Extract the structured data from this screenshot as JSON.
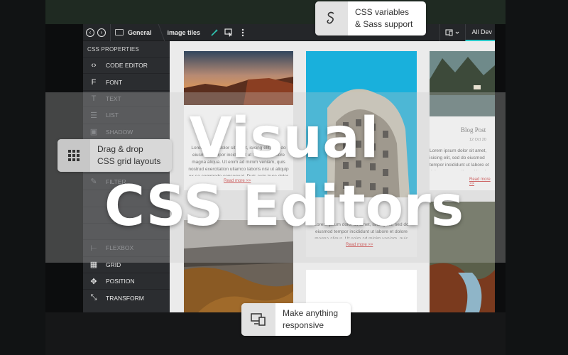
{
  "toolbar": {
    "back_icon": "arrow-left-circle",
    "forward_icon": "arrow-right-circle",
    "breadcrumb": [
      "General",
      "image tiles"
    ],
    "device_select": "All Dev"
  },
  "sidebar": {
    "header": "CSS PROPERTIES",
    "items": [
      {
        "label": "CODE EDITOR",
        "icon": "code-icon",
        "dim": false
      },
      {
        "label": "FONT",
        "icon": "font-icon",
        "dim": false
      },
      {
        "label": "TEXT",
        "icon": "text-icon",
        "dim": true
      },
      {
        "label": "LIST",
        "icon": "list-icon",
        "dim": true
      },
      {
        "label": "SHADOW",
        "icon": "shadow-icon",
        "dim": true
      },
      {
        "label": "",
        "icon": "",
        "dim": true
      },
      {
        "label": "",
        "icon": "",
        "dim": true
      },
      {
        "label": "FILTER",
        "icon": "filter-icon",
        "dim": true
      },
      {
        "label": "",
        "icon": "",
        "dim": true
      },
      {
        "label": "",
        "icon": "",
        "dim": true
      },
      {
        "label": "",
        "icon": "",
        "dim": true
      },
      {
        "label": "FLEXBOX",
        "icon": "flexbox-icon",
        "dim": true
      },
      {
        "label": "GRID",
        "icon": "grid-icon",
        "dim": false
      },
      {
        "label": "POSITION",
        "icon": "position-icon",
        "dim": false
      },
      {
        "label": "TRANSFORM",
        "icon": "transform-icon",
        "dim": false
      }
    ]
  },
  "content": {
    "cards": [
      {
        "title": "",
        "text": "Lorem ipsum dolor sit amet, isicing elit, sed do eiusmod tempor incididunt ut labore et dolore magna aliqua. Ut enim ad minim veniam, quis nostrud exercitation ullamco laboris nisi ut aliquip ex ea commodo consequat. Duis aute irure dolor in reprehenderit in voluptate velit esse cillum dolore eu fugiat nulla pariatur. Excepteur sint occaecat cupidatat non proident, sunt in culpa qui officia deserunt mollit anim id est laborum. Integer eget tellus ultrices, ullamcorper nibh id, fermentum felis. Mauris dignissim ut enim in auctor. Cras vel felis nec nibh finibus tincidunt. Proin ullamcorper tincidunt tellus, quis viverra nibh consequat sed. Maecenas nunc sapien, pretium sit amet urna at, laoreet efficitur ex. Aliquam erat volutpat.",
        "read_more": "Read more >>"
      },
      {
        "title": "Blog Post",
        "date": "12 Oct 20",
        "text": "Lorem ipsum dolor sit amet, isicing elit, sed do eiusmod tempor incididunt ut labore et dolore magna aliqua. Ut enim ad minim veniam, quis nostrud exercitation ullamco laboris nisi ut aliquip ex ea commodo consequat. Duis aute irure dolor in reprehenderit in voluptate velit esse cillum dolore eu fugiat nulla pariatur. Excepteur sint occaecat cupidatat non proident, sunt in culpa qui officia deserunt mollit anim id est laborum.",
        "read_more": "Read more >>"
      }
    ]
  },
  "overlay": {
    "headline_1": "Visual",
    "headline_2": "CSS Editors"
  },
  "callouts": {
    "sass": {
      "line1": "CSS variables",
      "line2": "& Sass support",
      "icon": "sass-icon"
    },
    "grid": {
      "line1": "Drag & drop",
      "line2": "CSS grid layouts",
      "icon": "grid-dots-icon"
    },
    "responsive": {
      "line1": "Make anything",
      "line2": "responsive",
      "icon": "responsive-devices-icon"
    }
  },
  "colors": {
    "accent": "#29c8c8",
    "link": "#d03a3a",
    "toolbar_bg": "#242629",
    "sidebar_bg": "#2b2d30"
  }
}
